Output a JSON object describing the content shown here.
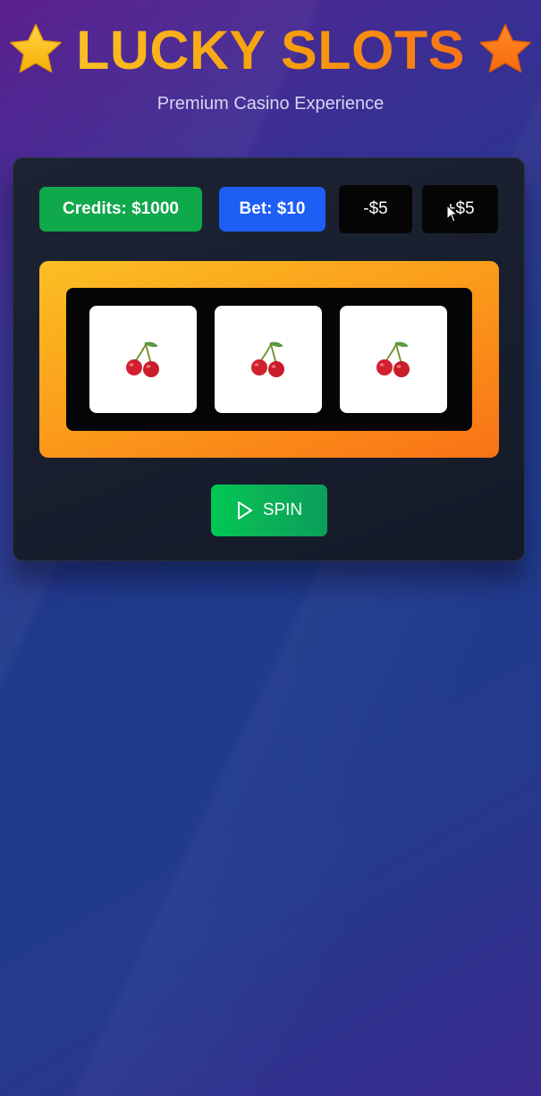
{
  "header": {
    "title": "LUCKY SLOTS",
    "subtitle": "Premium Casino Experience",
    "left_icon": "star-icon",
    "right_icon": "star-icon"
  },
  "stats": {
    "credits_label": "Credits: $1000",
    "bet_label": "Bet: $10"
  },
  "bet_controls": {
    "decrease_label": "-$5",
    "increase_label": "+$5"
  },
  "reels": [
    {
      "symbol": "cherry-icon"
    },
    {
      "symbol": "cherry-icon"
    },
    {
      "symbol": "cherry-icon"
    }
  ],
  "spin": {
    "label": "SPIN",
    "icon": "play-icon"
  },
  "colors": {
    "credits_bg": "#0fa84b",
    "bet_bg": "#1d5ef5",
    "gold": "#fbbf24",
    "orange": "#f97316",
    "spin_bg": "#00c853"
  }
}
